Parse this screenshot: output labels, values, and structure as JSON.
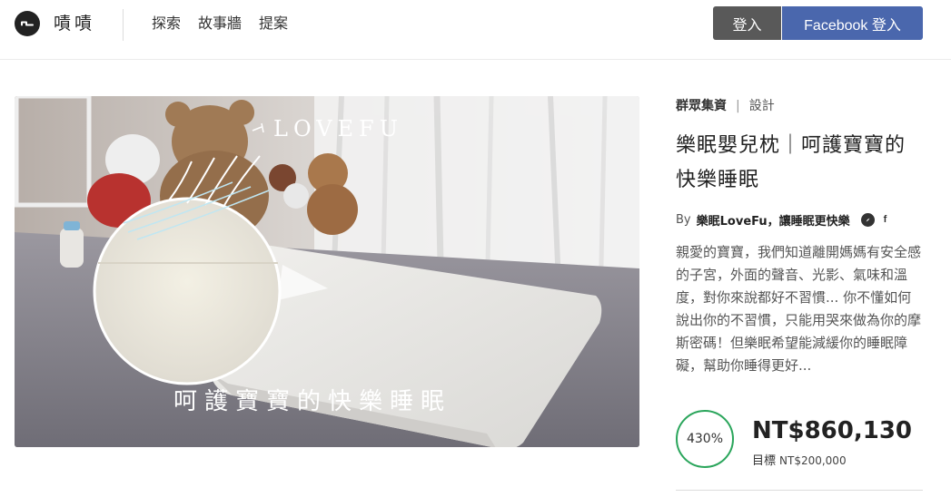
{
  "header": {
    "brand": "嘖嘖",
    "nav": [
      "探索",
      "故事牆",
      "提案"
    ],
    "login_label": "登入",
    "fb_login_label": "Facebook 登入"
  },
  "hero": {
    "logo_text": "LOVEFU",
    "caption": "呵護寶寶的快樂睡眠"
  },
  "project": {
    "category": "群眾集資",
    "subcategory": "設計",
    "title": "樂眠嬰兒枕｜呵護寶寶的快樂睡眠",
    "by_label": "By",
    "creator": "樂眠LoveFu，讓睡眠更快樂",
    "description": "親愛的寶寶，我們知道離開媽媽有安全感的子宮，外面的聲音、光影、氣味和溫度，對你來說都好不習慣... 你不懂如何說出你的不習慣，只能用哭來做為你的摩斯密碼！但樂眠希望能減緩你的睡眠障礙，幫助你睡得更好...",
    "progress_label": "430%",
    "amount": "NT$860,130",
    "goal_label": "目標",
    "goal_amount": "NT$200,000"
  },
  "colors": {
    "fb_blue": "#4a67ad",
    "login_gray": "#595959",
    "progress_green": "#2aa55b"
  },
  "icons": {
    "logo": "brand-logo-icon",
    "website": "compass-icon",
    "facebook": "facebook-icon"
  }
}
